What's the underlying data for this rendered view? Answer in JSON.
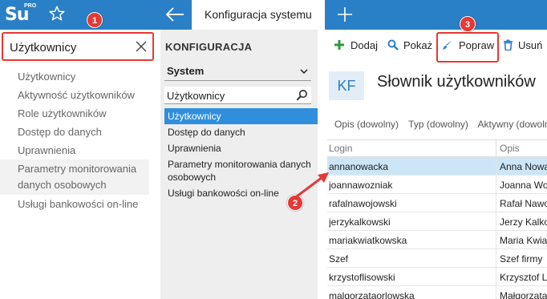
{
  "app": {
    "logo_main": "Su",
    "logo_sub": "PRO",
    "active_tab": "Konfiguracja systemu"
  },
  "search": {
    "value": "Użytkownicy"
  },
  "left_menu": {
    "items": [
      "Użytkownicy",
      "Aktywność użytkowników",
      "Role użytkowników",
      "Dostęp do danych",
      "Uprawnienia",
      "Parametry monitorowania danych osobowych",
      "Usługi bankowości on-line"
    ]
  },
  "config": {
    "title": "KONFIGURACJA",
    "select_value": "System",
    "filter_value": "Użytkownicy",
    "items": [
      "Użytkownicy",
      "Dostęp do danych",
      "Uprawnienia",
      "Parametry monitorowania danych osobowych",
      "Usługi bankowości on-line"
    ],
    "selected_index": 0
  },
  "toolbar": {
    "add_label": "Dodaj",
    "show_label": "Pokaż",
    "edit_label": "Popraw",
    "delete_label": "Usuń"
  },
  "content": {
    "badge": "KF",
    "title": "Słownik użytkowników",
    "filters": [
      "Opis (dowolny)",
      "Typ (dowolny)",
      "Aktywny (dowolny)"
    ],
    "columns": [
      "Login",
      "Opis"
    ],
    "rows": [
      {
        "login": "annanowacka",
        "opis": "Anna Nowacka"
      },
      {
        "login": "joannawozniak",
        "opis": "Joanna Woźniak"
      },
      {
        "login": "rafalnawojowski",
        "opis": "Rafał Nawojowski"
      },
      {
        "login": "jerzykalkowski",
        "opis": "Jerzy Kalkowski"
      },
      {
        "login": "mariakwiatkowska",
        "opis": "Maria Kwiatkowska"
      },
      {
        "login": "Szef",
        "opis": "Szef firmy"
      },
      {
        "login": "krzystoflisowski",
        "opis": "Krzysztof Lisowski"
      },
      {
        "login": "malgorzataorlowska",
        "opis": "Małgorzata Orłowska"
      }
    ],
    "selected_row": 0
  },
  "markers": {
    "m1": "1",
    "m2": "2",
    "m3": "3"
  },
  "colors": {
    "topbar": "#2a80c6",
    "selection": "#2f8fdd",
    "row_selection": "#cce6f7",
    "annotation": "#e53935",
    "add_icon": "#2e9a3a",
    "delete_icon": "#2a80c6"
  }
}
